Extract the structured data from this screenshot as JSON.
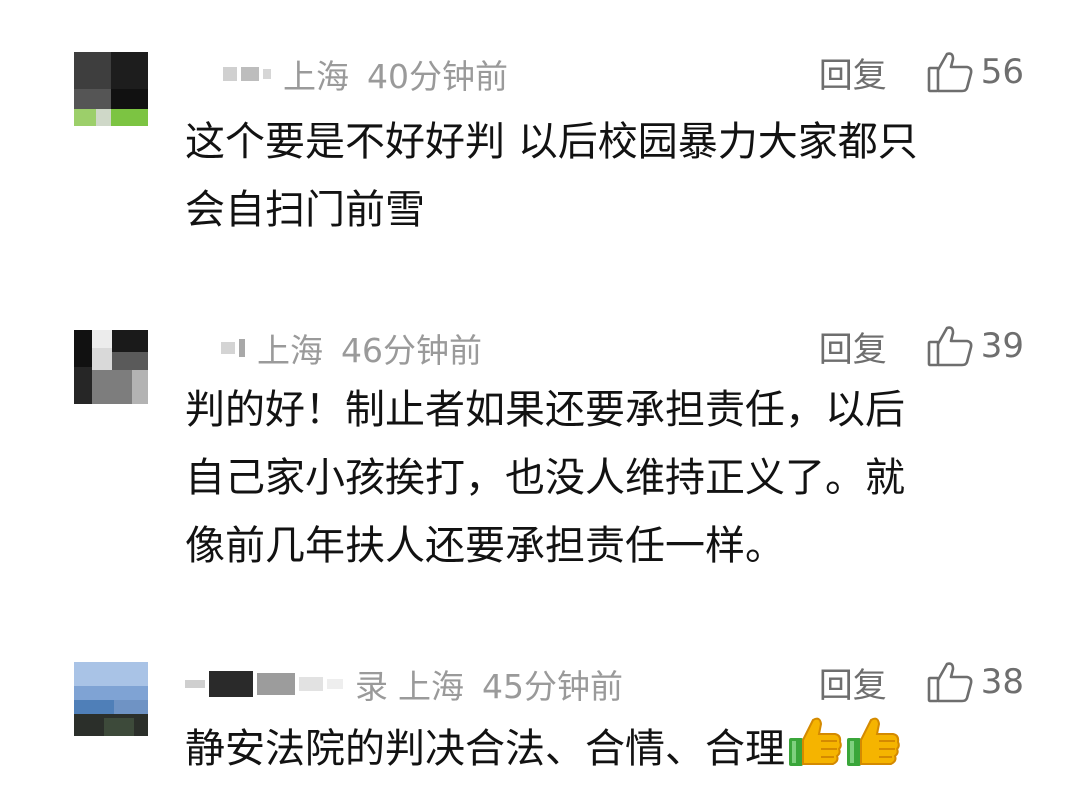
{
  "comments": [
    {
      "location": "上海",
      "time": "40分钟前",
      "reply_label": "回复",
      "likes": "56",
      "lines": [
        "这个要是不好好判 以后校园暴力大家都只",
        "会自扫门前雪"
      ]
    },
    {
      "location": "上海",
      "time": "46分钟前",
      "reply_label": "回复",
      "likes": "39",
      "lines": [
        "判的好！制止者如果还要承担责任，以后",
        "自己家小孩挨打，也没人维持正义了。就",
        "像前几年扶人还要承担责任一样。"
      ]
    },
    {
      "name_tail": "录",
      "location": "上海",
      "time": "45分钟前",
      "reply_label": "回复",
      "likes": "38",
      "lines": [
        "静安法院的判决合法、合情、合理"
      ],
      "trailing_emojis": [
        "thumbs-up-emoji",
        "thumbs-up-emoji"
      ]
    }
  ],
  "icons": {
    "like": "thumbs-up-outline-icon"
  },
  "colors": {
    "meta_text": "#9a9a9a",
    "action_text": "#6e6e6e",
    "body_text": "#121212"
  }
}
